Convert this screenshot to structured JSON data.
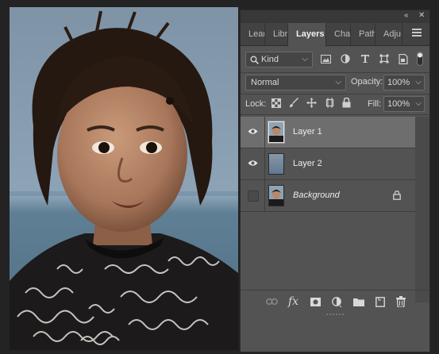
{
  "panel": {
    "collapse_glyph": "«",
    "close_glyph": "✕",
    "tabs": [
      {
        "label": "Lear",
        "active": false
      },
      {
        "label": "Libra",
        "active": false
      },
      {
        "label": "Layers",
        "active": true
      },
      {
        "label": "Char",
        "active": false
      },
      {
        "label": "Path",
        "active": false
      },
      {
        "label": "Adju",
        "active": false
      }
    ],
    "menu_icon": "hamburger-menu-icon"
  },
  "filter": {
    "kind_label": "Kind",
    "icons": [
      "pixel-filter-icon",
      "adjustment-filter-icon",
      "type-filter-icon",
      "shape-filter-icon",
      "smart-object-filter-icon",
      "filter-toggle-icon"
    ]
  },
  "blend": {
    "mode": "Normal",
    "opacity_label": "Opacity:",
    "opacity": "100%"
  },
  "lock": {
    "label": "Lock:",
    "icons": [
      "lock-transparent-icon",
      "lock-paint-icon",
      "lock-position-icon",
      "lock-artboard-icon",
      "lock-all-icon"
    ],
    "fill_label": "Fill:",
    "fill": "100%"
  },
  "layers": [
    {
      "name": "Layer 1",
      "visible": true,
      "selected": true,
      "italic": false,
      "locked": false,
      "thumb": "portrait"
    },
    {
      "name": "Layer 2",
      "visible": true,
      "selected": false,
      "italic": false,
      "locked": false,
      "thumb": "gradient"
    },
    {
      "name": "Background",
      "visible": false,
      "selected": false,
      "italic": true,
      "locked": true,
      "thumb": "portrait"
    }
  ],
  "bottom_actions": [
    "link-layers-icon",
    "fx-icon",
    "add-mask-icon",
    "adjustment-layer-icon",
    "group-folder-icon",
    "new-layer-icon",
    "trash-icon"
  ],
  "fx_label": "fx",
  "colors": {
    "panel_bg": "#535353",
    "selected_row": "#6e6e6e",
    "app_bg": "#232323"
  }
}
